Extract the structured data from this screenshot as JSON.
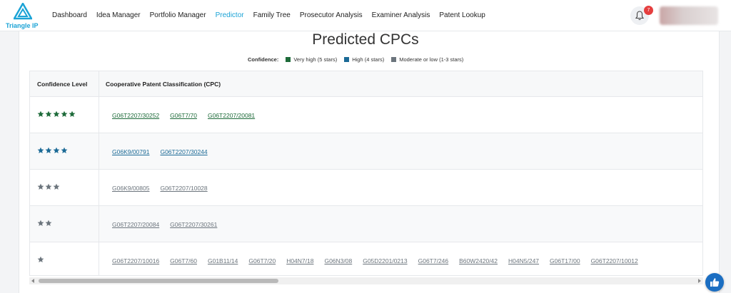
{
  "brand": {
    "name": "Triangle IP"
  },
  "nav": {
    "items": [
      {
        "label": "Dashboard",
        "active": false
      },
      {
        "label": "Idea Manager",
        "active": false
      },
      {
        "label": "Portfolio Manager",
        "active": false
      },
      {
        "label": "Predictor",
        "active": true
      },
      {
        "label": "Family Tree",
        "active": false
      },
      {
        "label": "Prosecutor Analysis",
        "active": false
      },
      {
        "label": "Examiner Analysis",
        "active": false
      },
      {
        "label": "Patent Lookup",
        "active": false
      }
    ],
    "notifications_count": "7",
    "accent_color": "#1ba3d6"
  },
  "page": {
    "title": "Predicted CPCs",
    "legend": {
      "label": "Confidence:",
      "items": [
        {
          "text": "Very high (5 stars)",
          "color": "#1e6b3a"
        },
        {
          "text": "High (4 stars)",
          "color": "#1b6a96"
        },
        {
          "text": "Moderate or low (1-3 stars)",
          "color": "#6c757d"
        }
      ]
    }
  },
  "table": {
    "headers": {
      "confidence": "Confidence Level",
      "cpc": "Cooperative Patent Classification (CPC)"
    },
    "rows": [
      {
        "stars": 5,
        "color": "#1e6b3a",
        "codes": [
          "G06T2207/30252",
          "G06T7/70",
          "G06T2207/20081"
        ]
      },
      {
        "stars": 4,
        "color": "#1b6a96",
        "codes": [
          "G06K9/00791",
          "G06T2207/30244"
        ]
      },
      {
        "stars": 3,
        "color": "#6c757d",
        "codes": [
          "G06K9/00805",
          "G06T2207/10028"
        ]
      },
      {
        "stars": 2,
        "color": "#6c757d",
        "codes": [
          "G06T2207/20084",
          "G06T2207/30261"
        ]
      },
      {
        "stars": 1,
        "color": "#6c757d",
        "codes": [
          "G06T2207/10016",
          "G06T7/60",
          "G01B11/14",
          "G06T7/20",
          "H04N7/18",
          "G06N3/08",
          "G05D2201/0213",
          "G06T7/246",
          "B60W2420/42",
          "H04N5/247",
          "G06T17/00",
          "G06T2207/10012"
        ]
      }
    ]
  }
}
